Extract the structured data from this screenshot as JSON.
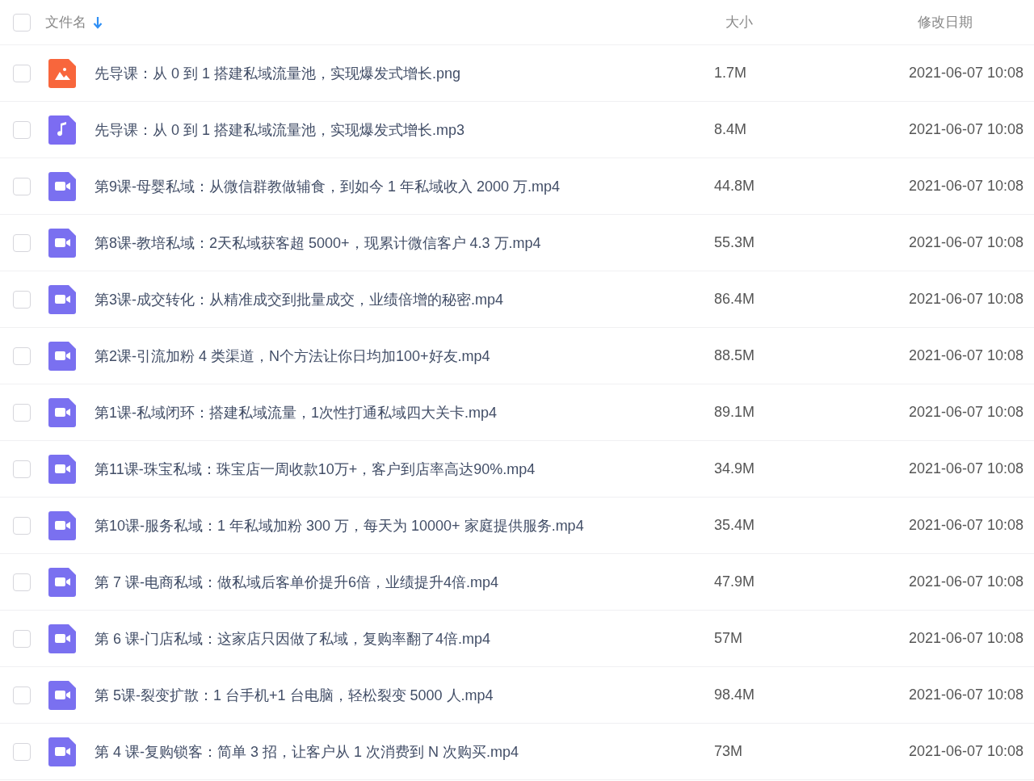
{
  "columns": {
    "select_all": {
      "checked": false
    },
    "name": "文件名",
    "size": "大小",
    "modified": "修改日期"
  },
  "rows": [
    {
      "kind": "image",
      "checked": false,
      "name": "先导课：从 0 到 1 搭建私域流量池，实现爆发式增长.png",
      "size": "1.7M",
      "modified": "2021-06-07 10:08"
    },
    {
      "kind": "audio",
      "checked": false,
      "name": "先导课：从 0 到 1 搭建私域流量池，实现爆发式增长.mp3",
      "size": "8.4M",
      "modified": "2021-06-07 10:08"
    },
    {
      "kind": "video",
      "checked": false,
      "name": "第9课-母婴私域：从微信群教做辅食，到如今 1 年私域收入 2000 万.mp4",
      "size": "44.8M",
      "modified": "2021-06-07 10:08"
    },
    {
      "kind": "video",
      "checked": false,
      "name": "第8课-教培私域：2天私域获客超 5000+，现累计微信客户 4.3 万.mp4",
      "size": "55.3M",
      "modified": "2021-06-07 10:08"
    },
    {
      "kind": "video",
      "checked": false,
      "name": "第3课-成交转化：从精准成交到批量成交，业绩倍增的秘密.mp4",
      "size": "86.4M",
      "modified": "2021-06-07 10:08"
    },
    {
      "kind": "video",
      "checked": false,
      "name": "第2课-引流加粉 4 类渠道，N个方法让你日均加100+好友.mp4",
      "size": "88.5M",
      "modified": "2021-06-07 10:08"
    },
    {
      "kind": "video",
      "checked": false,
      "name": "第1课-私域闭环：搭建私域流量，1次性打通私域四大关卡.mp4",
      "size": "89.1M",
      "modified": "2021-06-07 10:08"
    },
    {
      "kind": "video",
      "checked": false,
      "name": "第11课-珠宝私域：珠宝店一周收款10万+，客户到店率高达90%.mp4",
      "size": "34.9M",
      "modified": "2021-06-07 10:08"
    },
    {
      "kind": "video",
      "checked": false,
      "name": "第10课-服务私域：1 年私域加粉 300 万，每天为 10000+ 家庭提供服务.mp4",
      "size": "35.4M",
      "modified": "2021-06-07 10:08"
    },
    {
      "kind": "video",
      "checked": false,
      "name": "第 7 课-电商私域：做私域后客单价提升6倍，业绩提升4倍.mp4",
      "size": "47.9M",
      "modified": "2021-06-07 10:08"
    },
    {
      "kind": "video",
      "checked": false,
      "name": "第 6 课-门店私域：这家店只因做了私域，复购率翻了4倍.mp4",
      "size": "57M",
      "modified": "2021-06-07 10:08"
    },
    {
      "kind": "video",
      "checked": false,
      "name": "第 5课-裂变扩散：1 台手机+1 台电脑，轻松裂变 5000 人.mp4",
      "size": "98.4M",
      "modified": "2021-06-07 10:08"
    },
    {
      "kind": "video",
      "checked": false,
      "name": "第 4 课-复购锁客：简单 3 招，让客户从 1 次消费到 N 次购买.mp4",
      "size": "73M",
      "modified": "2021-06-07 10:08"
    }
  ]
}
